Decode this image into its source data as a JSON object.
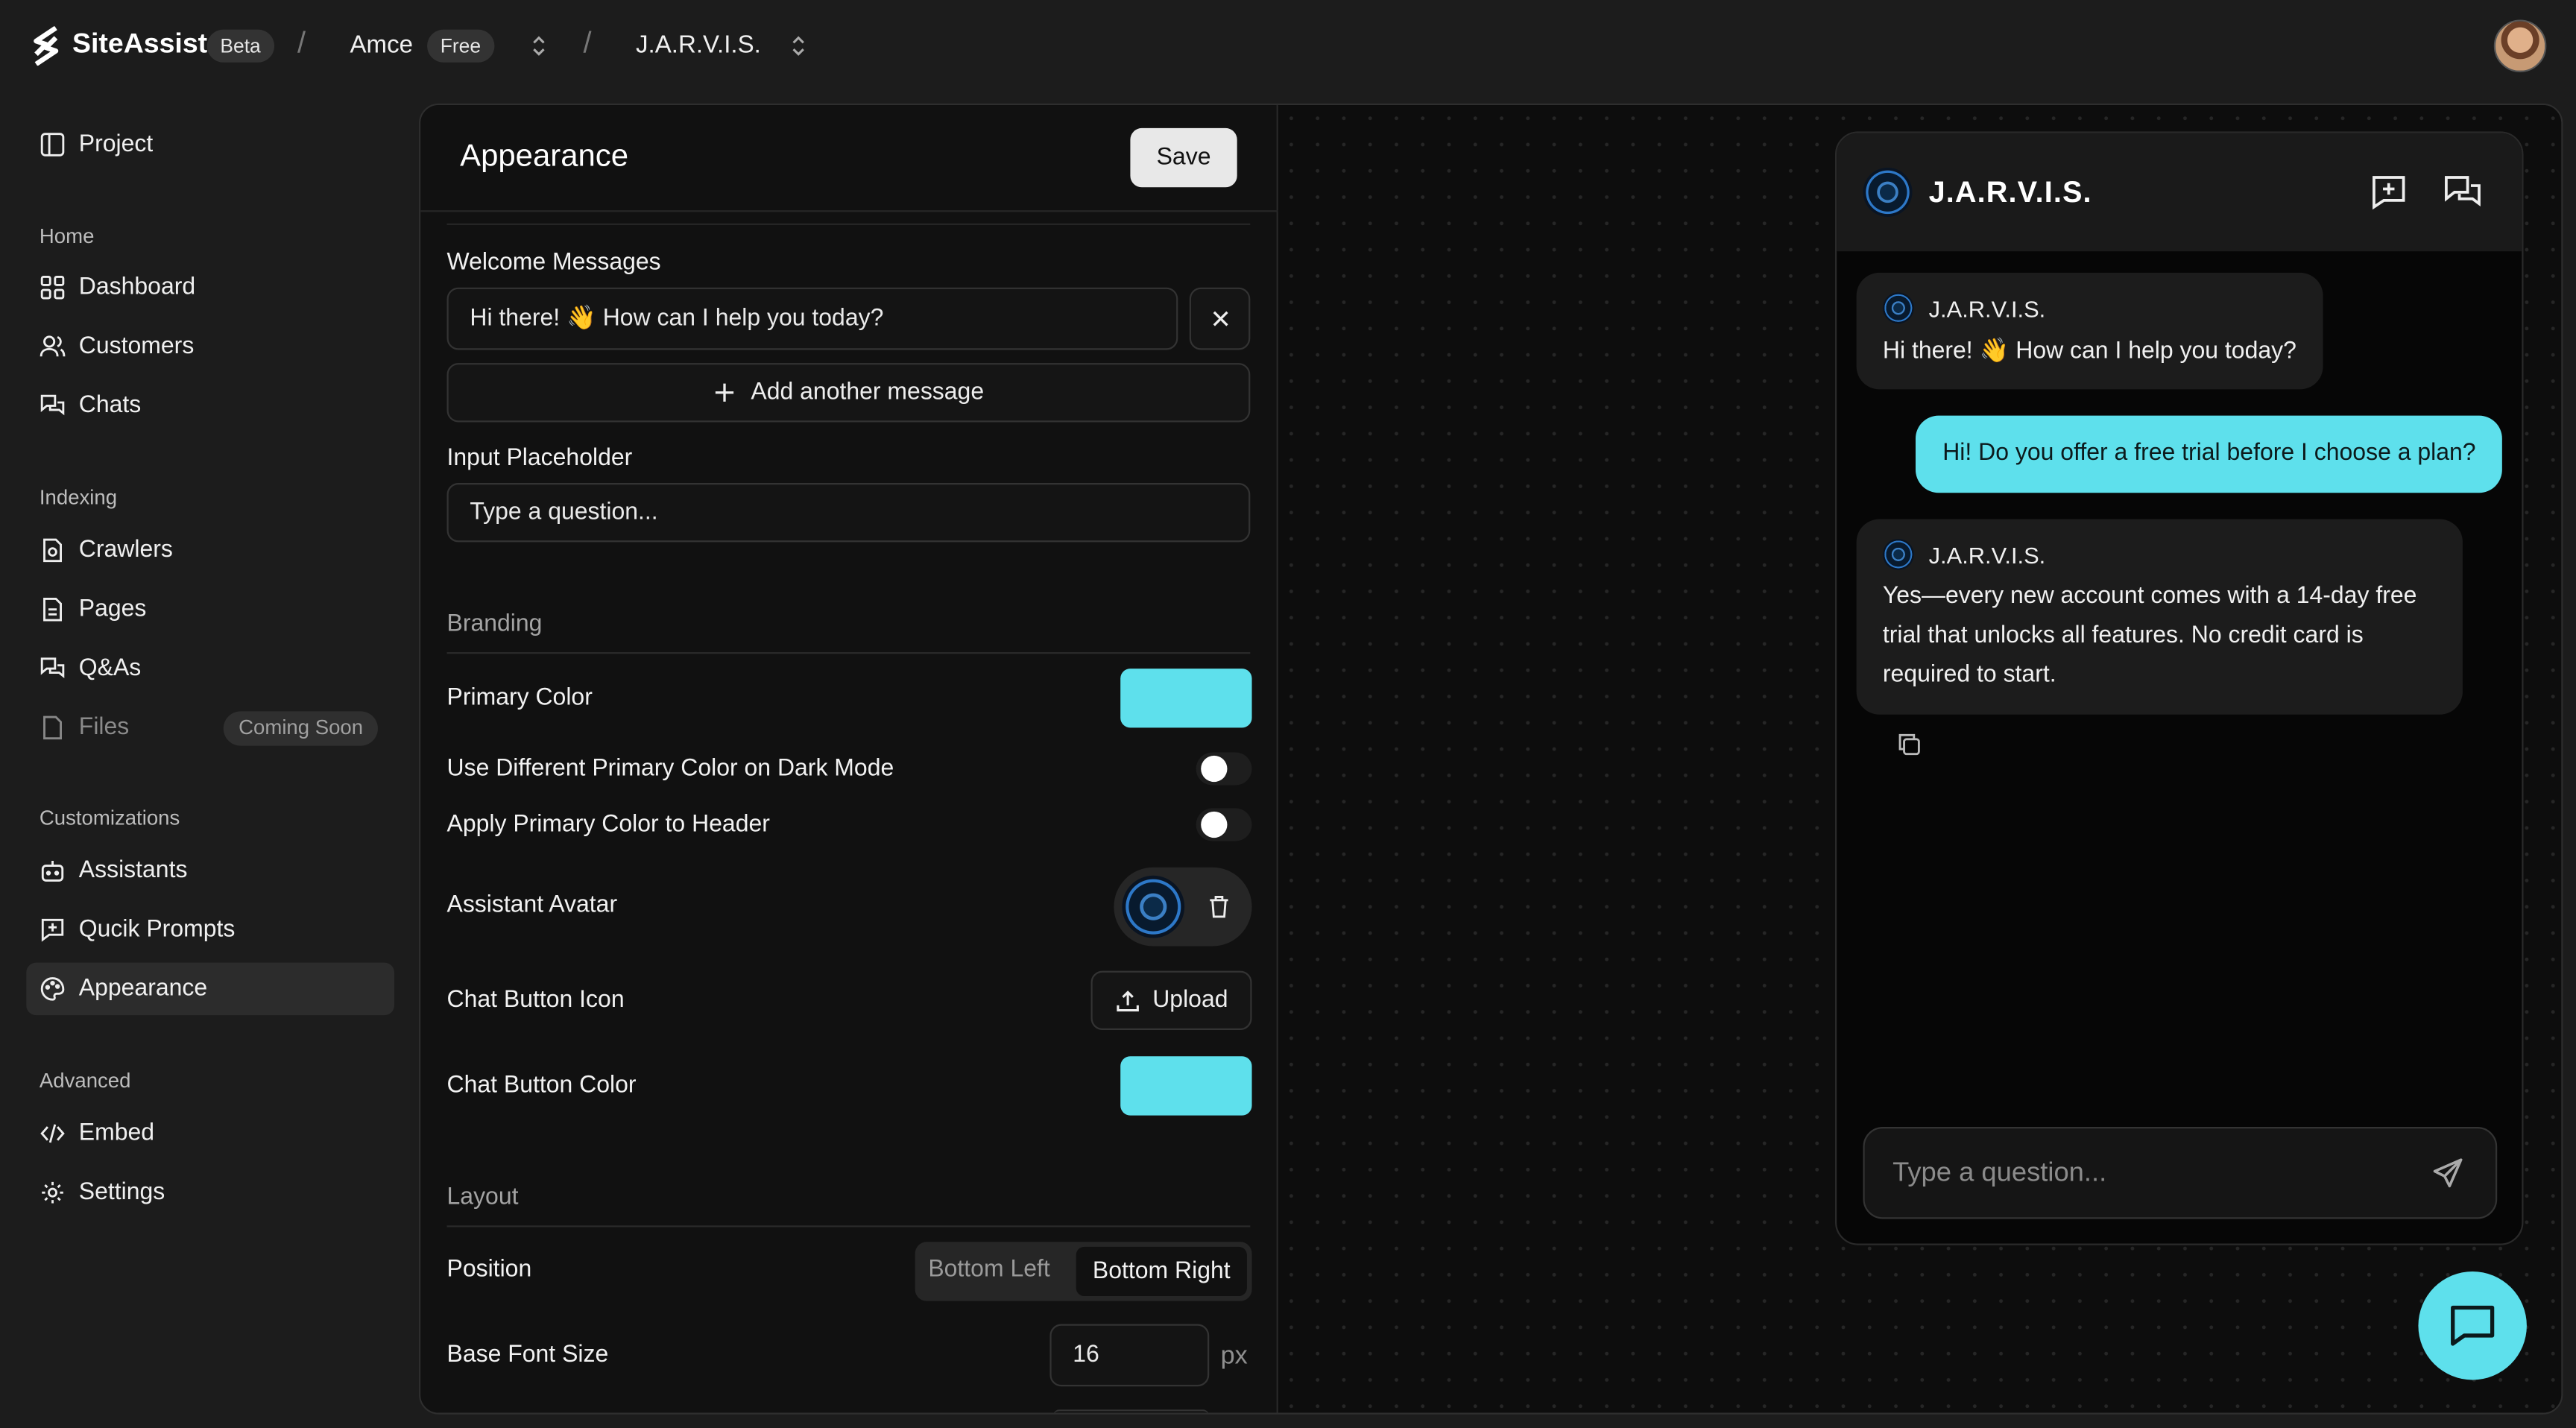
{
  "topbar": {
    "brand": "SiteAssist",
    "brand_badge": "Beta",
    "org": "Amce",
    "org_badge": "Free",
    "assistant": "J.A.R.V.I.S."
  },
  "sidebar": {
    "project": "Project",
    "sections": {
      "home": "Home",
      "indexing": "Indexing",
      "customizations": "Customizations",
      "advanced": "Advanced"
    },
    "items": {
      "dashboard": "Dashboard",
      "customers": "Customers",
      "chats": "Chats",
      "crawlers": "Crawlers",
      "pages": "Pages",
      "qas": "Q&As",
      "files": "Files",
      "files_badge": "Coming Soon",
      "assistants": "Assistants",
      "quick_prompts": "Qucik Prompts",
      "appearance": "Appearance",
      "embed": "Embed",
      "settings": "Settings"
    }
  },
  "settings": {
    "title": "Appearance",
    "save": "Save",
    "welcome_label": "Welcome Messages",
    "welcome_value": "Hi there! 👋 How can I help you today?",
    "add_message": "Add another message",
    "placeholder_label": "Input Placeholder",
    "placeholder_value": "Type a question...",
    "branding": "Branding",
    "primary_color": "Primary Color",
    "primary_color_hex": "#5ee0ec",
    "dark_mode": "Use Different Primary Color on Dark Mode",
    "dark_mode_on": false,
    "header_color": "Apply Primary Color to Header",
    "header_color_on": false,
    "avatar": "Assistant Avatar",
    "chat_icon": "Chat Button Icon",
    "upload": "Upload",
    "chat_color": "Chat Button Color",
    "chat_color_hex": "#5ee0ec",
    "layout": "Layout",
    "position": "Position",
    "pos_left": "Bottom Left",
    "pos_right": "Bottom Right",
    "position_selected": "Bottom Right",
    "font_size": "Base Font Size",
    "font_size_value": "16",
    "font_unit": "px"
  },
  "preview": {
    "name": "J.A.R.V.I.S.",
    "msg1_name": "J.A.R.V.I.S.",
    "msg1": "Hi there! 👋 How can I help you today?",
    "user_msg": "Hi! Do you offer a free trial before I choose a plan?",
    "msg2_name": "J.A.R.V.I.S.",
    "msg2_l1": "Yes—every new account comes with a 14-day free",
    "msg2_l2": "trial that unlocks all features. No credit card is",
    "msg2_l3": "required to start.",
    "input_placeholder": "Type a question..."
  }
}
